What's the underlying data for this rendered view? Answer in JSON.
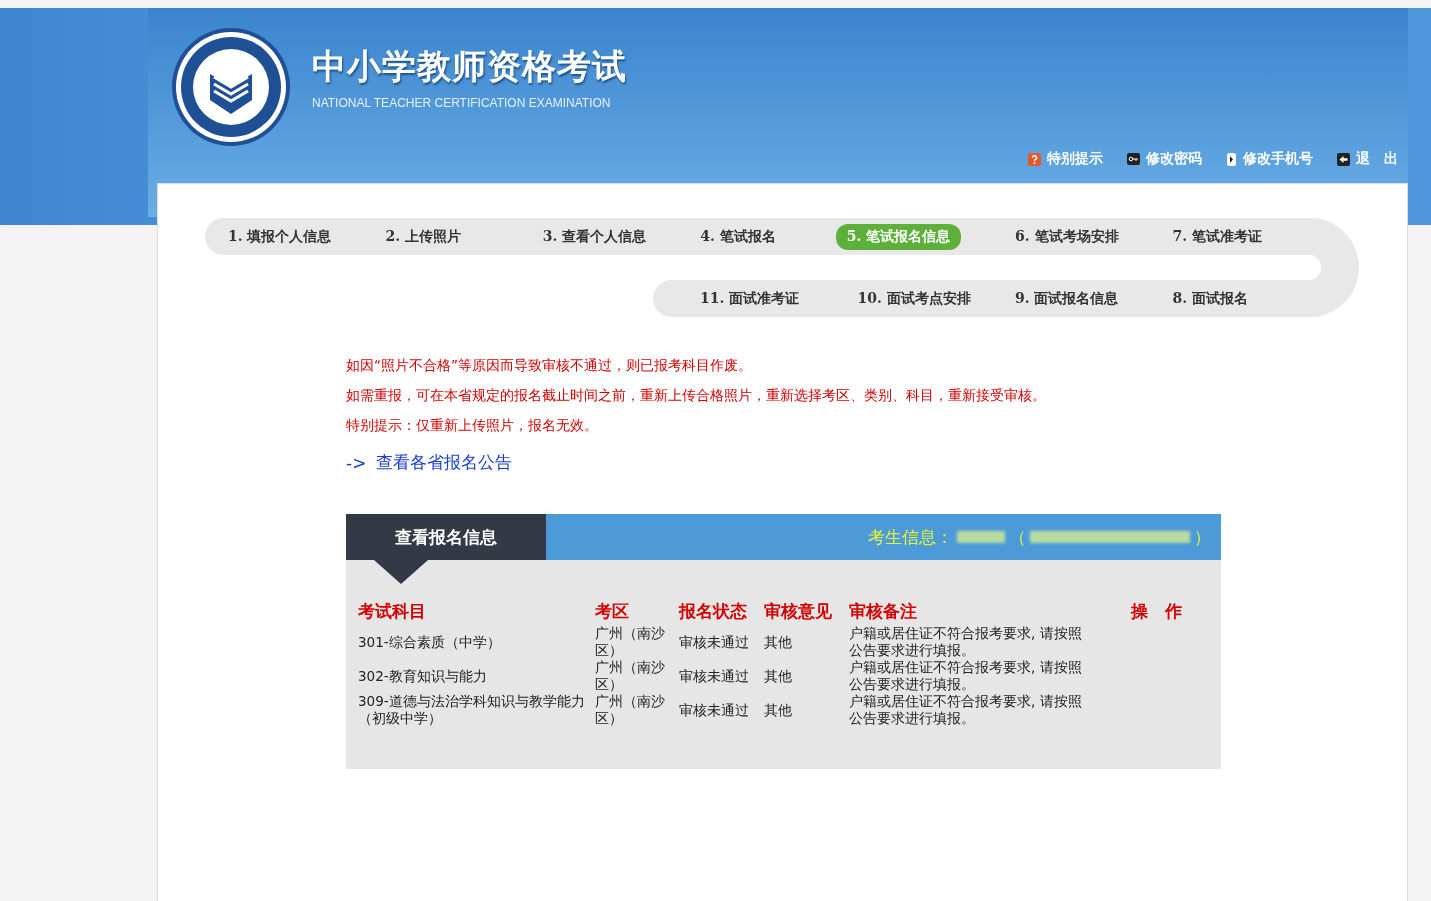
{
  "header": {
    "title": "中小学教师资格考试",
    "subtitle": "NATIONAL TEACHER CERTIFICATION EXAMINATION",
    "links": [
      {
        "kind": "help",
        "label": "特别提示"
      },
      {
        "kind": "password",
        "label": "修改密码"
      },
      {
        "kind": "phone",
        "label": "修改手机号"
      },
      {
        "kind": "logout",
        "label": "退　出"
      }
    ]
  },
  "steps_row_1": [
    {
      "label": "1. 填报个人信息",
      "selected": false
    },
    {
      "label": "2. 上传照片",
      "selected": false
    },
    {
      "label": "3. 查看个人信息",
      "selected": false
    },
    {
      "label": "4. 笔试报名",
      "selected": false
    },
    {
      "label": "5. 笔试报名信息",
      "selected": true
    },
    {
      "label": "6. 笔试考场安排",
      "selected": false
    },
    {
      "label": "7. 笔试准考证",
      "selected": false
    }
  ],
  "steps_row_2": [
    {
      "label": "11. 面试准考证",
      "selected": false
    },
    {
      "label": "10. 面试考点安排",
      "selected": false
    },
    {
      "label": "9. 面试报名信息",
      "selected": false
    },
    {
      "label": "8. 面试报名",
      "selected": false
    }
  ],
  "notices": [
    "如因“照片不合格”等原因而导致审核不通过，则已报考科目作废。",
    "如需重报，可在本省规定的报名截止时间之前，重新上传合格照片，重新选择考区、类别、科目，重新接受审核。",
    "特别提示：仅重新上传照片，报名无效。"
  ],
  "link": {
    "arrow": "->",
    "label": "查看各省报名公告"
  },
  "panel": {
    "title": "查看报名信息",
    "candidate_label": "考生信息：",
    "open_paren": "（",
    "close_paren": "）",
    "columns": [
      "考试科目",
      "考区",
      "报名状态",
      "审核意见",
      "审核备注",
      "操　作"
    ],
    "rows": [
      [
        "301-综合素质（中学）",
        "广州（南沙区）",
        "审核未通过",
        "其他",
        "户籍或居住证不符合报考要求, 请按照公告要求进行填报。"
      ],
      [
        "302-教育知识与能力",
        "广州（南沙区）",
        "审核未通过",
        "其他",
        "户籍或居住证不符合报考要求, 请按照公告要求进行填报。"
      ],
      [
        "309-道德与法治学科知识与教学能力（初级中学）",
        "广州（南沙区）",
        "审核未通过",
        "其他",
        "户籍或居住证不符合报考要求, 请按照公告要求进行填报。"
      ]
    ]
  }
}
